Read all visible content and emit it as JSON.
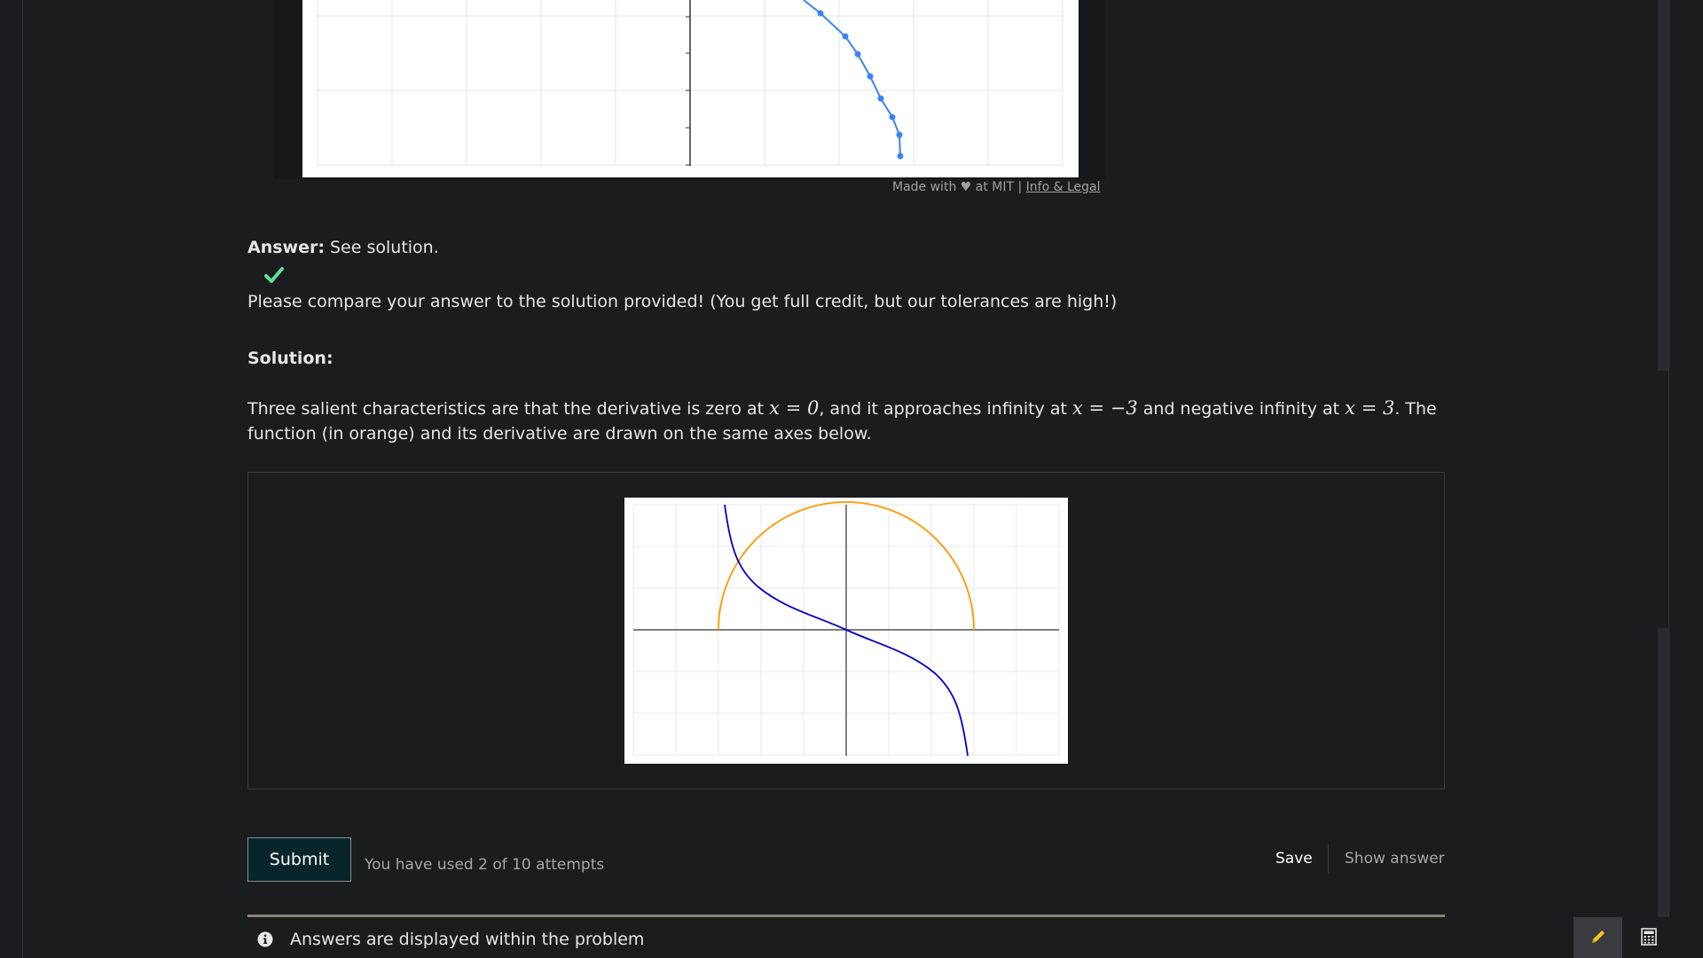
{
  "top_graph": {
    "footer": {
      "made_with": "Made with ♥ at MIT |",
      "link": "Info & Legal"
    }
  },
  "answer": {
    "label": "Answer:",
    "text": " See solution.",
    "status_icon": "checkmark-icon",
    "status_color": "#5ee0a0"
  },
  "feedback": "Please compare your answer to the solution provided! (You get full credit, but our tolerances are high!)",
  "solution": {
    "heading": "Solution:",
    "seg1": "Three salient characteristics are that the derivative is zero at ",
    "math1": "x = 0",
    "seg2": ", and it approaches infinity at ",
    "math2": "x = −3",
    "seg3": " and negative infinity at ",
    "math3": "x = 3",
    "seg4": ". The function (in orange) and its derivative are drawn on the same axes below."
  },
  "colors": {
    "function_curve": "#ff9900",
    "derivative_curve": "#0000cc",
    "sketch_curve": "#3b82f6"
  },
  "controls": {
    "submit_label": "Submit",
    "attempts_text": "You have used 2 of 10 attempts",
    "save_label": "Save",
    "show_answer_label": "Show answer"
  },
  "notice": {
    "icon": "info-icon",
    "text": "Answers are displayed within the problem"
  },
  "toolbar": {
    "pencil_icon": "pencil-icon",
    "calculator_icon": "calculator-icon"
  }
}
